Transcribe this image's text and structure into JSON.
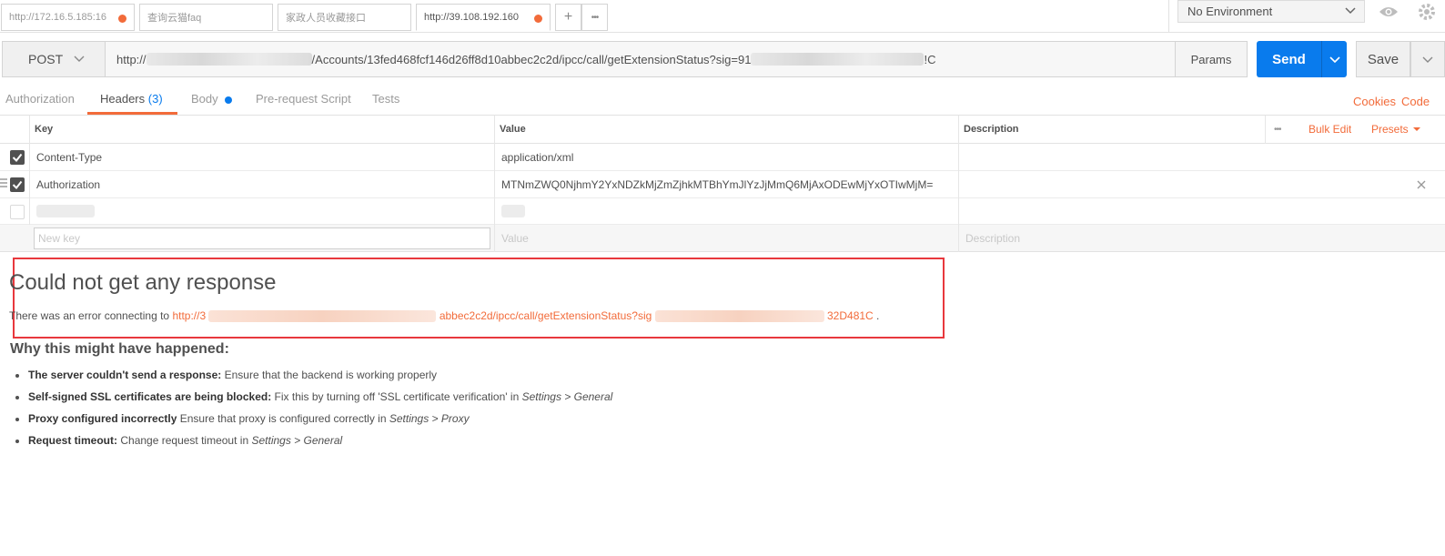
{
  "tabs": [
    {
      "label": "http://172.16.5.185:16",
      "unsaved": true
    },
    {
      "label": "查询云猫faq",
      "unsaved": false
    },
    {
      "label": "家政人员收藏接口",
      "unsaved": false
    },
    {
      "label": "http://39.108.192.160",
      "unsaved": true
    }
  ],
  "tab_actions": {
    "add": "+",
    "more": "•••"
  },
  "environment": {
    "selected": "No Environment"
  },
  "request": {
    "method": "POST",
    "url_prefix": "http://",
    "url_middle": "/Accounts/13fed468fcf146d26ff8d10abbec2c2d/ipcc/call/getExtensionStatus?sig=91",
    "url_suffix": "!C",
    "params_label": "Params",
    "send_label": "Send",
    "save_label": "Save"
  },
  "request_tabs": {
    "authorization": "Authorization",
    "headers": "Headers",
    "headers_count": "(3)",
    "body": "Body",
    "prerequest": "Pre-request Script",
    "tests": "Tests",
    "cookies": "Cookies",
    "code": "Code"
  },
  "headers_table": {
    "col_key": "Key",
    "col_value": "Value",
    "col_description": "Description",
    "bulk_edit": "Bulk Edit",
    "presets": "Presets",
    "rows": [
      {
        "key": "Content-Type",
        "value": "application/xml",
        "enabled": true
      },
      {
        "key": "Authorization",
        "value": "MTNmZWQ0NjhmY2YxNDZkMjZmZjhkMTBhYmJlYzJjMmQ6MjAxODEwMjYxOTIwMjM=",
        "enabled": true
      }
    ],
    "new_key_placeholder": "New key",
    "new_value_placeholder": "Value",
    "new_description_placeholder": "Description"
  },
  "response": {
    "title": "Could not get any response",
    "error_prefix": "There was an error connecting to ",
    "error_link_start": "http://3",
    "error_link_middle": "abbec2c2d/ipcc/call/getExtensionStatus?sig",
    "error_link_end": "32D481C",
    "error_suffix": ".",
    "why_title": "Why this might have happened:",
    "reasons": [
      {
        "bold": "The server couldn't send a response:",
        "text": "Ensure that the backend is working properly",
        "italic": "",
        "tail": ""
      },
      {
        "bold": "Self-signed SSL certificates are being blocked:",
        "text": "Fix this by turning off 'SSL certificate verification' in",
        "italic": "Settings > General",
        "tail": ""
      },
      {
        "bold": "Proxy configured incorrectly",
        "text": "Ensure that proxy is configured correctly in",
        "italic": "Settings > Proxy",
        "tail": ""
      },
      {
        "bold": "Request timeout:",
        "text": "Change request timeout in",
        "italic": "Settings > General",
        "tail": ""
      }
    ]
  },
  "colors": {
    "accent_orange": "#f26b3a",
    "primary_blue": "#097bed",
    "highlight_red": "#e8383d"
  }
}
